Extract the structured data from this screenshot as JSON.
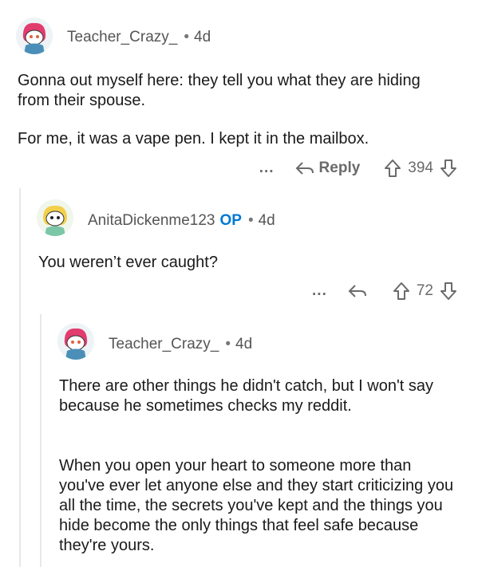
{
  "comment1": {
    "author": "Teacher_Crazy_",
    "age": "4d",
    "paragraphs": [
      "Gonna out myself here: they tell you what they are hiding from their spouse.",
      "For me, it was a vape pen. I kept it in the mailbox."
    ],
    "more": "...",
    "reply_label": "Reply",
    "score": "394"
  },
  "comment2": {
    "author": "AnitaDickenme123",
    "op_badge": "OP",
    "age": "4d",
    "paragraphs": [
      "You weren’t ever caught?"
    ],
    "more": "...",
    "score": "72"
  },
  "comment3": {
    "author": "Teacher_Crazy_",
    "age": "4d",
    "paragraphs": [
      "There are other things he didn't catch, but I won't say because he sometimes checks my reddit.",
      "When you open your heart to someone more than you've ever let anyone else and they start criticizing you all the time, the secrets you've kept and the things you hide become the only things that feel safe because they're yours."
    ]
  },
  "colors": {
    "op": "#0079d3",
    "thread_line": "#e8e8e8",
    "muted": "#6a6a6a"
  },
  "icons": [
    "avatar-teacher-crazy",
    "avatar-anita",
    "reply-arrow-icon",
    "upvote-icon",
    "downvote-icon"
  ]
}
